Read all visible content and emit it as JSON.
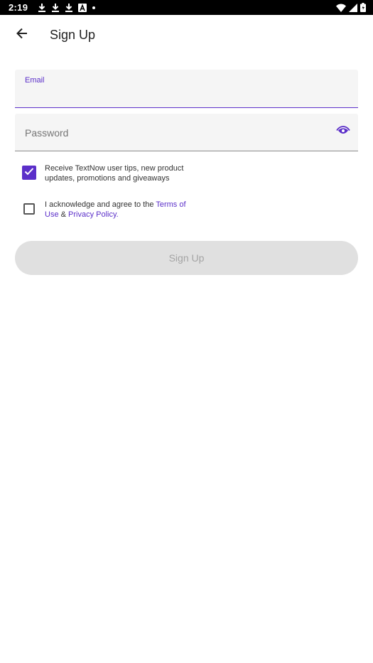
{
  "status_bar": {
    "time": "2:19",
    "left_icons": [
      "download-icon",
      "download-icon",
      "download-icon",
      "font-a-icon",
      "dot-icon"
    ],
    "right_icons": [
      "wifi-icon",
      "cellular-icon",
      "battery-icon"
    ]
  },
  "app_bar": {
    "back_icon": "arrow-left-icon",
    "title": "Sign Up"
  },
  "form": {
    "email": {
      "label": "Email",
      "value": ""
    },
    "password": {
      "placeholder": "Password",
      "value": "",
      "toggle_icon": "eye-icon"
    },
    "tips_checkbox": {
      "checked": true,
      "text": "Receive TextNow user tips, new product updates, promotions and giveaways"
    },
    "terms_checkbox": {
      "checked": false,
      "text_prefix": "I acknowledge and agree to the ",
      "terms_link": "Terms of Use",
      "separator": " & ",
      "privacy_link": "Privacy Policy",
      "text_suffix": "."
    },
    "submit": {
      "label": "Sign Up",
      "enabled": false
    }
  },
  "colors": {
    "accent": "#5b2fc9",
    "status_bar_bg": "#000000",
    "field_bg": "#f5f5f5",
    "disabled_button_bg": "#e0e0e0",
    "disabled_button_text": "#a4a4a4"
  }
}
